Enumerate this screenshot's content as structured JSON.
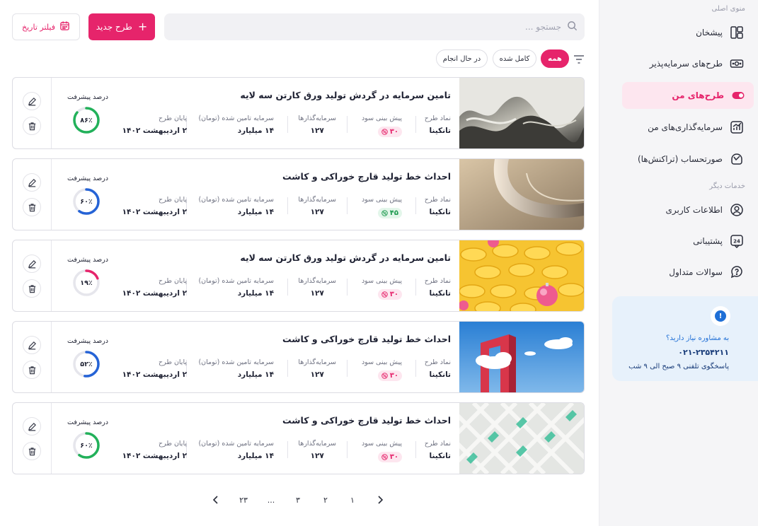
{
  "sidebar": {
    "main_menu_title": "منوی اصلی",
    "other_services_title": "خدمات دیگر",
    "items": [
      {
        "label": "پیشخان",
        "icon": "dashboard-icon"
      },
      {
        "label": "طرح‌های سرمایه‌پذیر",
        "icon": "money-icon"
      },
      {
        "label": "طرح‌های من",
        "icon": "toggle-icon",
        "active": true
      },
      {
        "label": "سرمایه‌گذاری‌های من",
        "icon": "chart-icon"
      },
      {
        "label": "صورتحساب (تراکنش‌ها)",
        "icon": "wallet-icon"
      }
    ],
    "other_items": [
      {
        "label": "اطلاعات کاربری",
        "icon": "user-icon"
      },
      {
        "label": "پشتیبانی",
        "icon": "support-24-icon"
      },
      {
        "label": "سوالات متداول",
        "icon": "faq-icon"
      }
    ],
    "consult": {
      "question": "به مشاوره نیاز دارید؟",
      "phone": "۰۲۱-۲۳۵۴۲۱۱",
      "hours": "پاسخگوی تلفنی ۹ صبح الی ۹ شب"
    }
  },
  "toolbar": {
    "search_placeholder": "جستجو ...",
    "new_plan_label": "طرح جدید",
    "date_filter_label": "فیلتر تاریخ"
  },
  "tabs": [
    {
      "label": "همه",
      "active": true
    },
    {
      "label": "کامل شده"
    },
    {
      "label": "در حال انجام"
    }
  ],
  "field_labels": {
    "symbol": "نماد طرح",
    "profit": "پیش بینی سود",
    "investors": "سرمایه‌گذارها",
    "funded": "سرمایه تامین شده (تومان)",
    "end": "پایان طرح",
    "progress": "درصد پیشرفت"
  },
  "plans": [
    {
      "title": "تامین سرمایه در گردش تولید ورق کارتن سه لایه",
      "symbol": "تانکینا",
      "profit": "۳۰",
      "profit_type": "negative",
      "investors": "۱۲۷",
      "funded": "۱۴ میلیارد",
      "end": "۲ اردیبهشت ۱۴۰۲",
      "progress_text": "۸۶٪",
      "progress": 86,
      "ring_color": "#22b15a",
      "image": "wave"
    },
    {
      "title": "احداث خط تولید قارچ خوراکی و کاشت",
      "symbol": "تانکینا",
      "profit": "۴۵",
      "profit_type": "positive",
      "investors": "۱۲۷",
      "funded": "۱۴ میلیارد",
      "end": "۲ اردیبهشت ۱۴۰۲",
      "progress_text": "۶۰٪",
      "progress": 60,
      "ring_color": "#2563d6",
      "image": "curve"
    },
    {
      "title": "تامین سرمایه در گردش تولید ورق کارتن سه لایه",
      "symbol": "تانکینا",
      "profit": "۳۰",
      "profit_type": "negative",
      "investors": "۱۲۷",
      "funded": "۱۴ میلیارد",
      "end": "۲ اردیبهشت ۱۴۰۲",
      "progress_text": "۱۹٪",
      "progress": 19,
      "ring_color": "#e6246b",
      "image": "yellow"
    },
    {
      "title": "احداث خط تولید قارچ خوراکی و کاشت",
      "symbol": "تانکینا",
      "profit": "۳۰",
      "profit_type": "negative",
      "investors": "۱۲۷",
      "funded": "۱۴ میلیارد",
      "end": "۲ اردیبهشت ۱۴۰۲",
      "progress_text": "۵۲٪",
      "progress": 52,
      "ring_color": "#2563d6",
      "image": "sky"
    },
    {
      "title": "احداث خط تولید قارچ خوراکی و کاشت",
      "symbol": "تانکینا",
      "profit": "۳۰",
      "profit_type": "negative",
      "investors": "۱۲۷",
      "funded": "۱۴ میلیارد",
      "end": "۲ اردیبهشت ۱۴۰۲",
      "progress_text": "۶۰٪",
      "progress": 60,
      "ring_color": "#22b15a",
      "image": "lattice"
    }
  ],
  "pagination": {
    "pages": [
      "۱",
      "۲",
      "۳",
      "...",
      "۲۳"
    ]
  },
  "colors": {
    "accent": "#e6246b",
    "positive": "#22b15a",
    "negative": "#e6246b"
  }
}
